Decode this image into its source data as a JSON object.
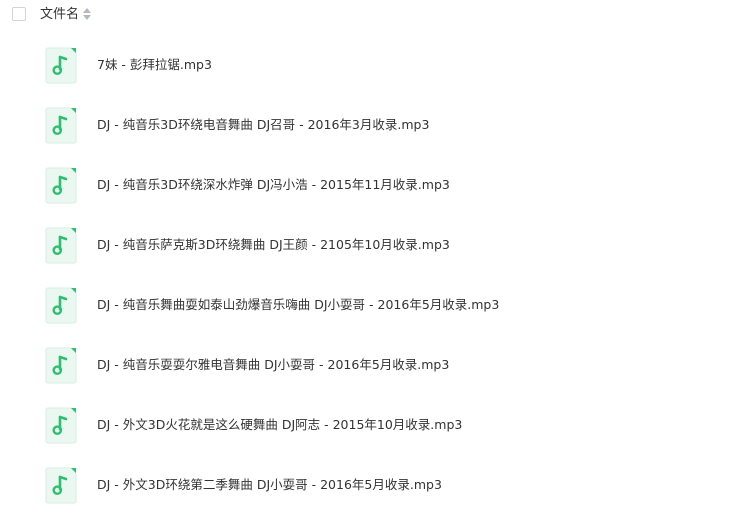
{
  "header": {
    "column_label": "文件名"
  },
  "files": [
    {
      "name": "7妹 - 彭拜拉锯.mp3",
      "icon": "music-file-icon"
    },
    {
      "name": "DJ - 纯音乐3D环绕电音舞曲 DJ召哥 - 2016年3月收录.mp3",
      "icon": "music-file-icon"
    },
    {
      "name": "DJ - 纯音乐3D环绕深水炸弹 DJ冯小浩 - 2015年11月收录.mp3",
      "icon": "music-file-icon"
    },
    {
      "name": "DJ - 纯音乐萨克斯3D环绕舞曲 DJ王颜 - 2105年10月收录.mp3",
      "icon": "music-file-icon"
    },
    {
      "name": "DJ - 纯音乐舞曲耍如泰山劲爆音乐嗨曲 DJ小耍哥 - 2016年5月收录.mp3",
      "icon": "music-file-icon"
    },
    {
      "name": "DJ - 纯音乐耍耍尔雅电音舞曲 DJ小耍哥 - 2016年5月收录.mp3",
      "icon": "music-file-icon"
    },
    {
      "name": "DJ - 外文3D火花就是这么硬舞曲 DJ阿志 - 2015年10月收录.mp3",
      "icon": "music-file-icon"
    },
    {
      "name": "DJ - 外文3D环绕第二季舞曲 DJ小耍哥 - 2016年5月收录.mp3",
      "icon": "music-file-icon"
    }
  ],
  "colors": {
    "icon_bg": "#eaf8f1",
    "icon_border": "#d6efe2",
    "icon_accent": "#2fbf71",
    "text": "#333333"
  }
}
